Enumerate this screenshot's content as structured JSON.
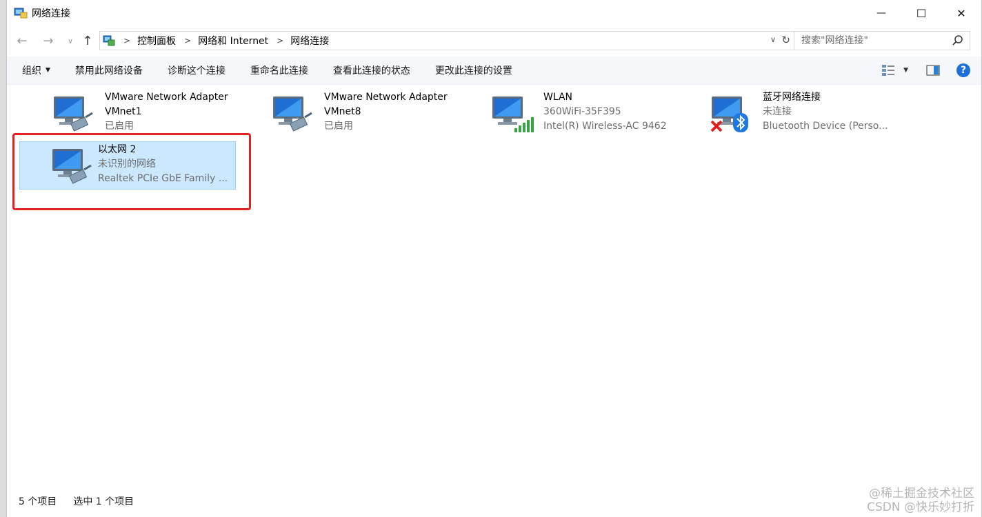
{
  "window": {
    "title": "网络连接",
    "minimize_glyph": "—",
    "maximize_glyph": "☐",
    "close_glyph": "✕"
  },
  "address": {
    "crumbs": [
      "控制面板",
      "网络和 Internet",
      "网络连接"
    ],
    "search_placeholder": "搜索\"网络连接\""
  },
  "toolbar": {
    "organize": "组织",
    "commands": [
      "禁用此网络设备",
      "诊断这个连接",
      "重命名此连接",
      "查看此连接的状态",
      "更改此连接的设置"
    ]
  },
  "adapters": [
    {
      "name": "VMware Network Adapter",
      "name2": "VMnet1",
      "status": "已启用",
      "device": "",
      "overlay": "cable-icon"
    },
    {
      "name": "VMware Network Adapter",
      "name2": "VMnet8",
      "status": "已启用",
      "device": "",
      "overlay": "cable-icon"
    },
    {
      "name": "WLAN",
      "status": "360WiFi-35F395",
      "device": "Intel(R) Wireless-AC 9462",
      "overlay": "signal-bars-icon"
    },
    {
      "name": "蓝牙网络连接",
      "status": "未连接",
      "device": "Bluetooth Device (Perso...",
      "overlay": "bluetooth-icon"
    },
    {
      "name": "以太网 2",
      "status": "未识别的网络",
      "device": "Realtek PCIe GbE Family ...",
      "overlay": "cable-icon",
      "selected": true
    }
  ],
  "statusbar": {
    "count": "5 个项目",
    "selected": "选中 1 个项目"
  },
  "watermark": {
    "line1": "@稀土掘金技术社区",
    "line2": "CSDN @快乐妙打折"
  },
  "colors": {
    "selection_bg": "#cce8ff",
    "selection_border": "#99d1ff",
    "highlight_red": "#e52222",
    "help_blue": "#1e6fd9"
  }
}
